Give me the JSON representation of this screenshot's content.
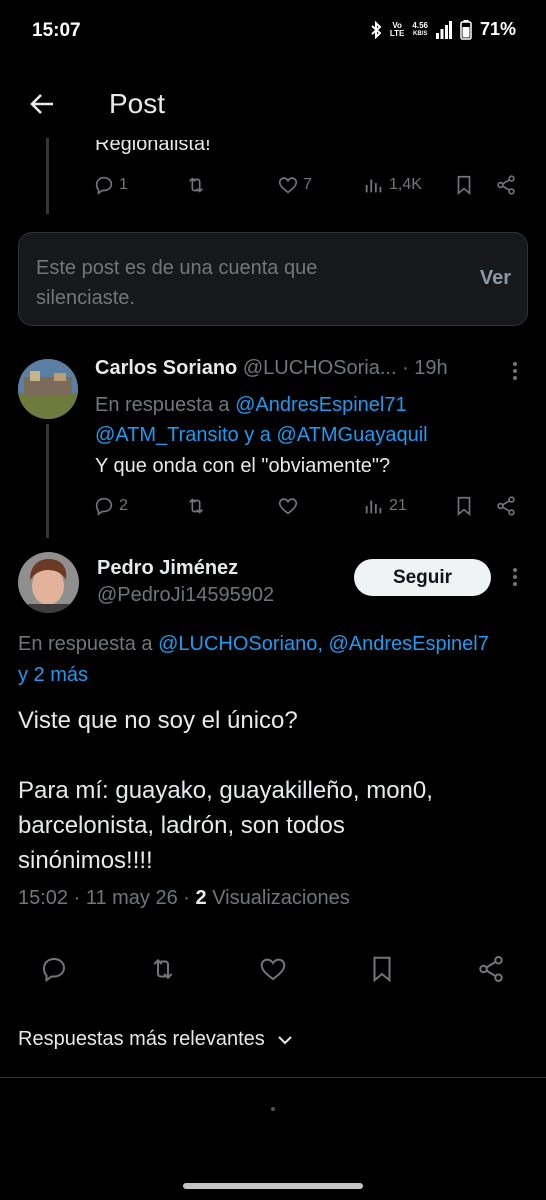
{
  "status_bar": {
    "time": "15:07",
    "volte_top": "Vo",
    "volte_bottom": "LTE",
    "net_speed_top": "4.56",
    "net_speed_bottom": "KB/S",
    "battery": "71%"
  },
  "header": {
    "title": "Post"
  },
  "previous_post": {
    "cut_text": "Regionalista!",
    "replies": "1",
    "likes": "7",
    "views": "1,4K"
  },
  "muted_notice": {
    "text": "Este post es de una cuenta que silenciaste.",
    "link": "Ver"
  },
  "reply_post": {
    "name": "Carlos Soriano",
    "handle": "@LUCHOSoria...",
    "time": "· 19h",
    "replying_prefix": "En respuesta a",
    "mention1": "@AndresEspinel71",
    "mention2": "@ATM_Transito",
    "replying_join": "y a",
    "mention3": "@ATMGuayaquil",
    "text": "Y que onda con el \"obviamente\"?",
    "replies": "2",
    "likes": "",
    "views": "21"
  },
  "main_post": {
    "name": "Pedro Jiménez",
    "handle": "@PedroJi14595902",
    "follow_label": "Seguir",
    "replying_prefix": "En respuesta a",
    "mention_line": "@LUCHOSoriano, @AndresEspinel7",
    "more": "y 2 más",
    "text_line1": "Viste que no soy el único?",
    "text_line2": "Para mí: guayako, guayakilleño, mon0,",
    "text_line3": "barcelonista, ladrón, son todos",
    "text_line4": "sinónimos!!!!",
    "timestamp": "15:02 · 11 may 26 ·",
    "views_count": "2",
    "views_label": "Visualizaciones"
  },
  "replies_sort": {
    "label": "Respuestas más relevantes"
  },
  "colors": {
    "background": "#000000",
    "accent_blue": "#1d9bf0",
    "secondary_text": "#71767b",
    "primary_text": "#e7e9ea"
  }
}
